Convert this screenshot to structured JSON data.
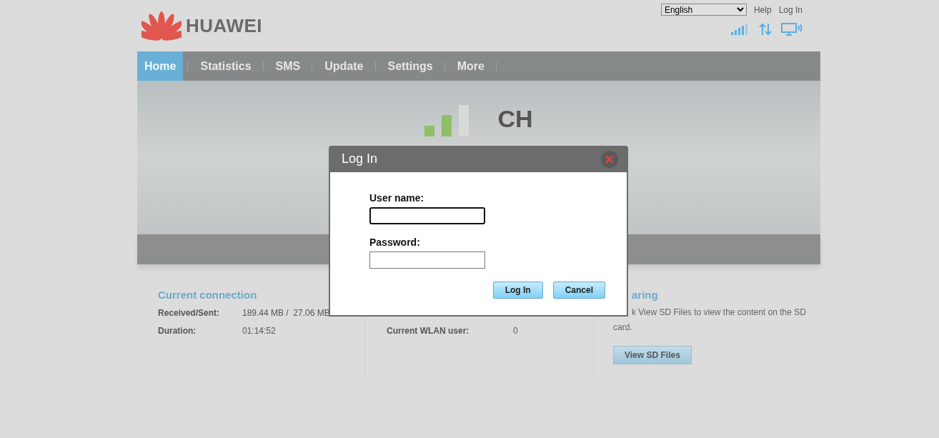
{
  "header": {
    "brand": "HUAWEI",
    "language": "English",
    "links": [
      "Help",
      "Log In"
    ]
  },
  "nav": [
    {
      "label": "Home",
      "selected": true
    },
    {
      "label": "Statistics",
      "selected": false
    },
    {
      "label": "SMS",
      "selected": false
    },
    {
      "label": "Update",
      "selected": false
    },
    {
      "label": "Settings",
      "selected": false
    },
    {
      "label": "More",
      "selected": false
    }
  ],
  "banner": {
    "operator": "CH"
  },
  "sections": [
    {
      "title": "Current connection",
      "rows": [
        {
          "label": "Received/Sent:",
          "value": "189.44 MB /  27.06 MB"
        },
        {
          "label": "Duration:",
          "value": "01:14:52"
        }
      ]
    },
    {
      "rows": [
        {
          "label": "Current WLAN user:",
          "value": "0"
        }
      ]
    },
    {
      "title": "aring",
      "text": "k View SD Files to view the content on the SD card.",
      "button": "View SD Files"
    }
  ],
  "dialog": {
    "title": "Log In",
    "fields": [
      {
        "label": "User name:",
        "focused": true
      },
      {
        "label": "Password:",
        "focused": false
      }
    ],
    "buttons": [
      "Log In",
      "Cancel"
    ]
  }
}
